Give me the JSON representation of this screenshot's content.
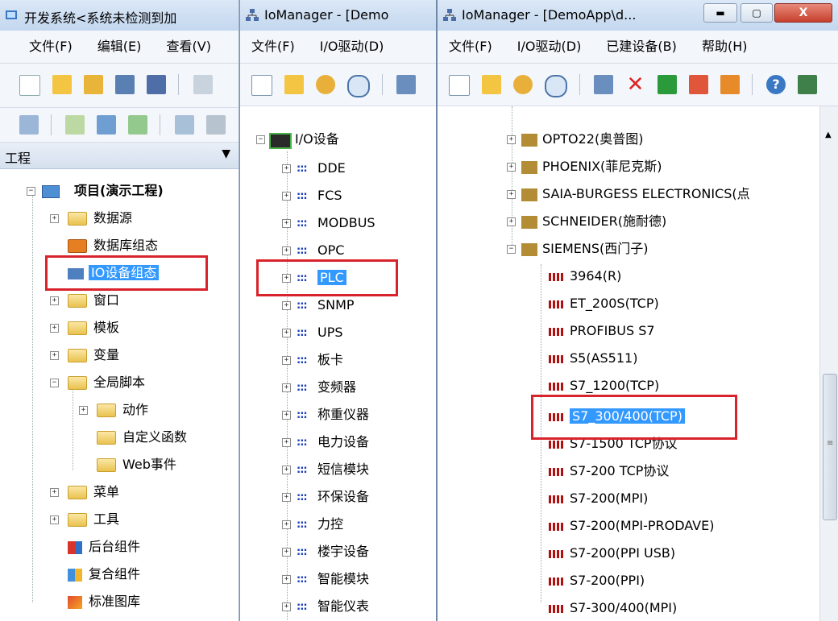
{
  "win1": {
    "title": "开发系统<系统未检测到加",
    "menu": [
      "文件(F)",
      "编辑(E)",
      "查看(V)"
    ],
    "panel_title": "工程",
    "tree": [
      {
        "label": "项目(演示工程)"
      },
      {
        "label": "数据源"
      },
      {
        "label": "数据库组态"
      },
      {
        "label": "IO设备组态"
      },
      {
        "label": "窗口"
      },
      {
        "label": "模板"
      },
      {
        "label": "变量"
      },
      {
        "label": "全局脚本"
      },
      {
        "label": "动作"
      },
      {
        "label": "自定义函数"
      },
      {
        "label": "Web事件"
      },
      {
        "label": "菜单"
      },
      {
        "label": "工具"
      },
      {
        "label": "后台组件"
      },
      {
        "label": "复合组件"
      },
      {
        "label": "标准图库"
      }
    ]
  },
  "win2": {
    "title": "IoManager - [Demo",
    "menu": [
      "文件(F)",
      "I/O驱动(D)"
    ],
    "root": "I/O设备",
    "items": [
      "DDE",
      "FCS",
      "MODBUS",
      "OPC",
      "PLC",
      "SNMP",
      "UPS",
      "板卡",
      "变频器",
      "称重仪器",
      "电力设备",
      "短信模块",
      "环保设备",
      "力控",
      "楼宇设备",
      "智能模块",
      "智能仪表"
    ]
  },
  "win3": {
    "title": "IoManager - [DemoApp\\d...",
    "menu": [
      "文件(F)",
      "I/O驱动(D)",
      "已建设备(B)",
      "帮助(H)"
    ],
    "vendors": [
      "OPTO22(奥普图)",
      "PHOENIX(菲尼克斯)",
      "SAIA-BURGESS ELECTRONICS(点",
      "SCHNEIDER(施耐德)",
      "SIEMENS(西门子)"
    ],
    "drivers": [
      "3964(R)",
      "ET_200S(TCP)",
      "PROFIBUS S7",
      "S5(AS511)",
      "S7_1200(TCP)",
      "S7_300/400(TCP)",
      "S7-1500 TCP协议",
      "S7-200 TCP协议",
      "S7-200(MPI)",
      "S7-200(MPI-PRODAVE)",
      "S7-200(PPI USB)",
      "S7-200(PPI)",
      "S7-300/400(MPI)"
    ]
  }
}
